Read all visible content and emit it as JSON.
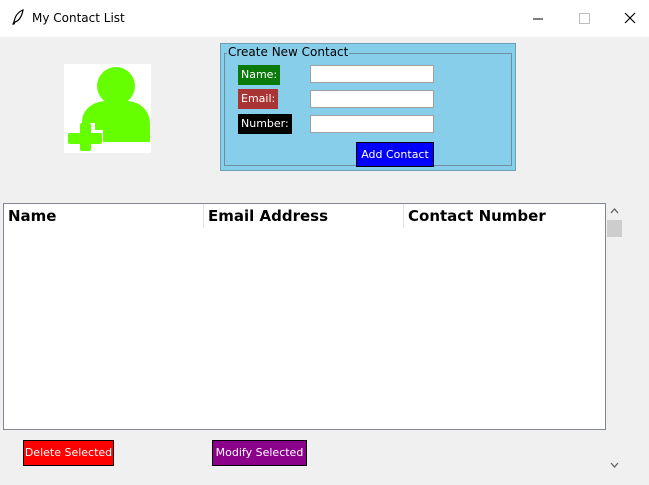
{
  "window": {
    "title": "My Contact List",
    "controls": [
      "minimize-icon",
      "maximize-icon",
      "close-icon"
    ]
  },
  "logo": {
    "icon": "add-user-icon",
    "color": "#66ff00"
  },
  "form": {
    "frame_title": "Create New Contact",
    "background": "#87ceeb",
    "fields": {
      "name": {
        "label": "Name:",
        "value": "",
        "label_color": "#0a7a0a"
      },
      "email": {
        "label": "Email:",
        "value": "",
        "label_color": "#a93434"
      },
      "number": {
        "label": "Number:",
        "value": "",
        "label_color": "#000000"
      }
    },
    "add_button": {
      "label": "Add Contact",
      "color": "#0000ff"
    }
  },
  "table": {
    "columns": [
      "Name",
      "Email Address",
      "Contact Number"
    ],
    "rows": []
  },
  "actions": {
    "delete": {
      "label": "Delete Selected",
      "color": "#ff0000"
    },
    "modify": {
      "label": "Modify Selected",
      "color": "#8b008b"
    }
  }
}
